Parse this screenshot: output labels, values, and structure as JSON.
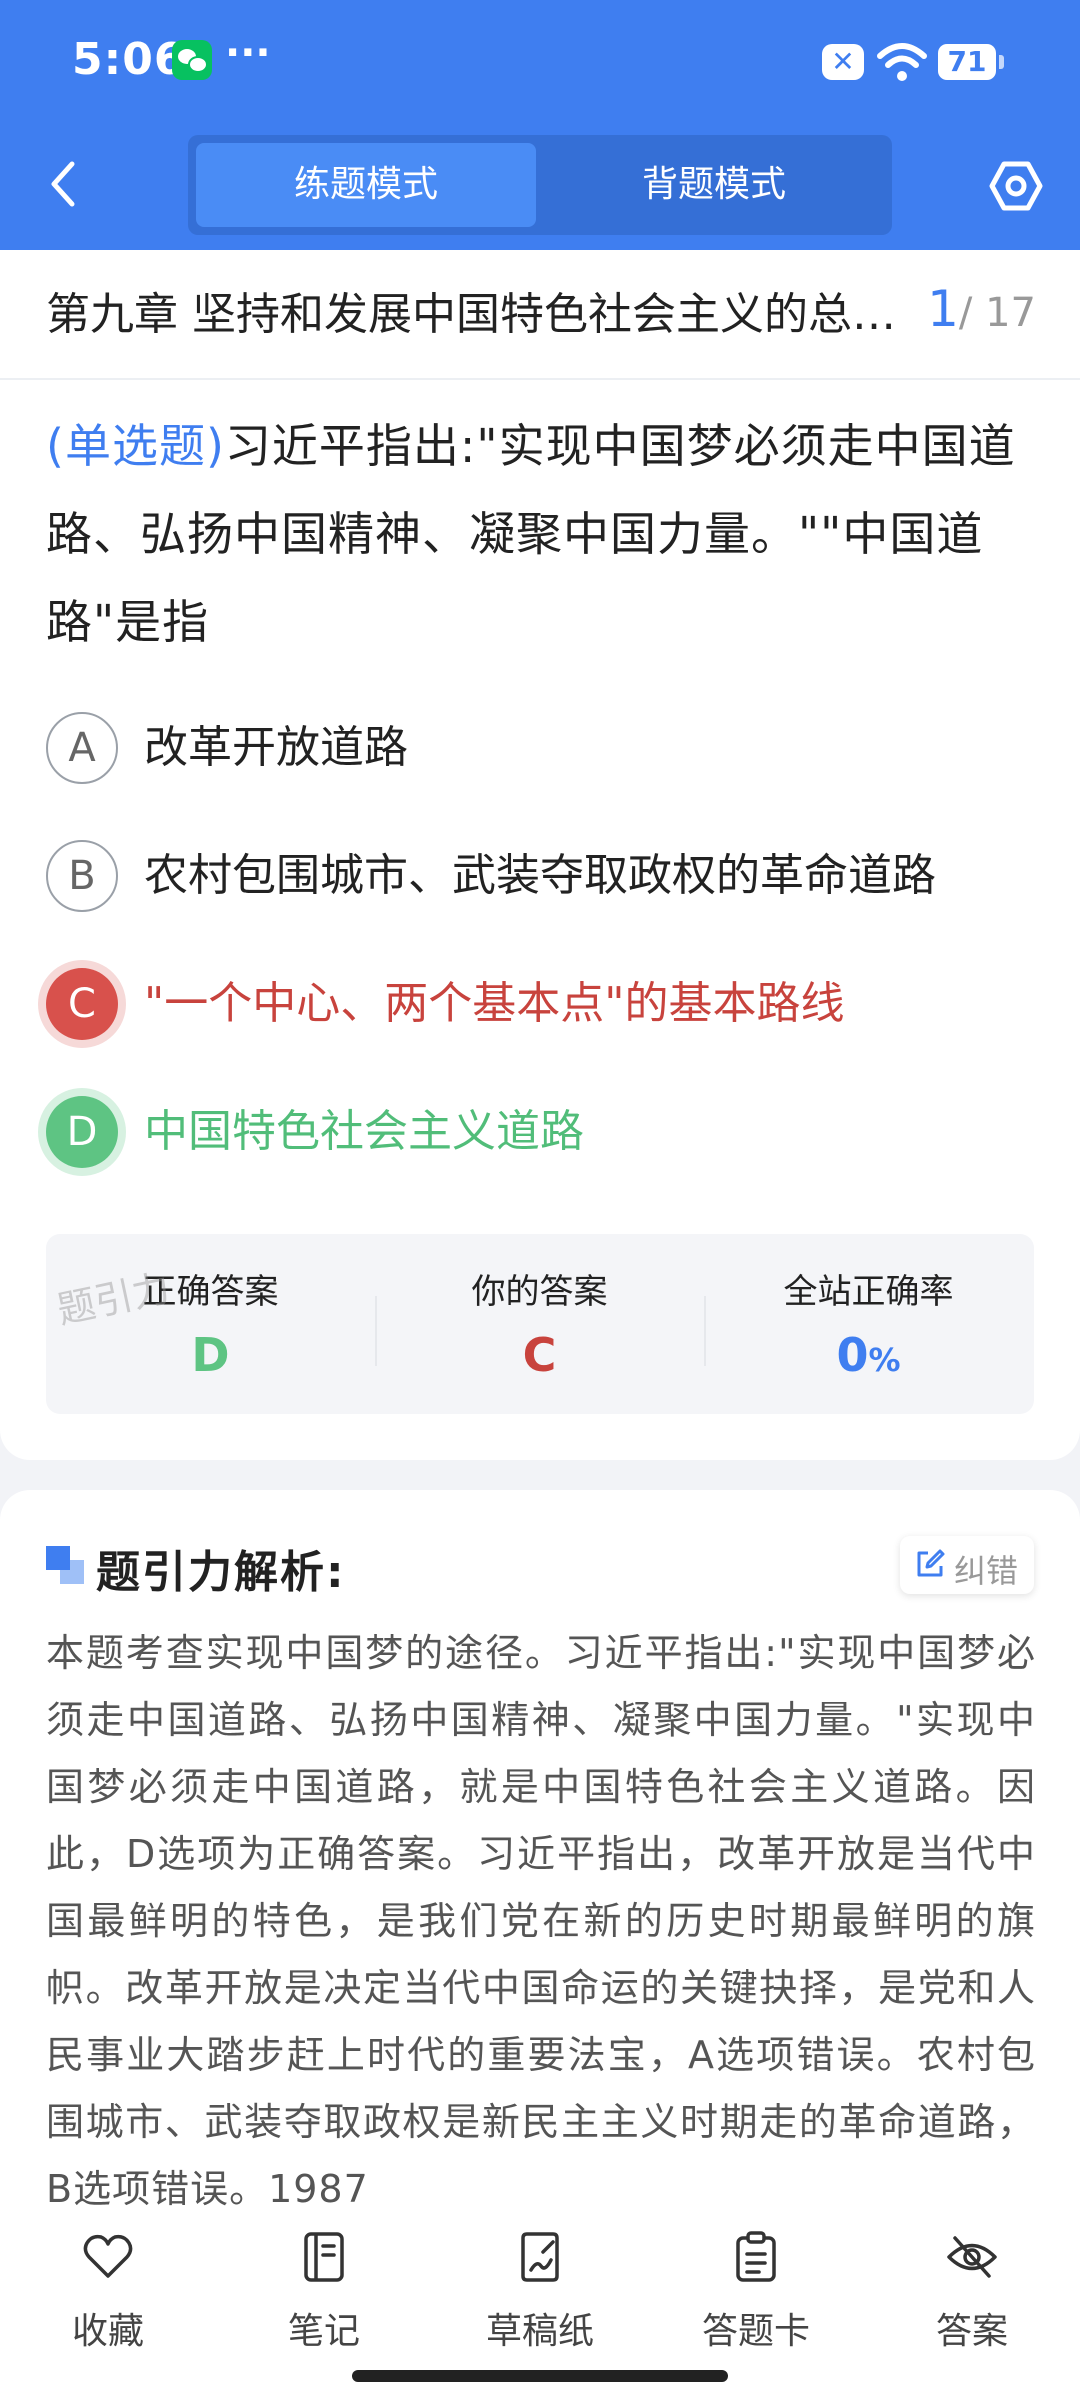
{
  "status_bar": {
    "time": "5:06",
    "dots": "···",
    "battery": "71"
  },
  "header": {
    "modes": [
      "练题模式",
      "背题模式"
    ],
    "active_mode": 0
  },
  "chapter": {
    "title": "第九章 坚持和发展中国特色社会主义的总任务",
    "current": "1",
    "total": "/ 17"
  },
  "question": {
    "type": "(单选题)",
    "stem": "习近平指出:\"实现中国梦必须走中国道路、弘扬中国精神、凝聚中国力量。\"\"中国道路\"是指",
    "options": [
      {
        "letter": "A",
        "text": "改革开放道路",
        "state": "normal"
      },
      {
        "letter": "B",
        "text": "农村包围城市、武装夺取政权的革命道路",
        "state": "normal"
      },
      {
        "letter": "C",
        "text": "\"一个中心、两个基本点\"的基本路线",
        "state": "wrong"
      },
      {
        "letter": "D",
        "text": "中国特色社会主义道路",
        "state": "right"
      }
    ]
  },
  "result": {
    "correct_label": "正确答案",
    "correct_value": "D",
    "yours_label": "你的答案",
    "yours_value": "C",
    "rate_label": "全站正确率",
    "rate_value": "0",
    "rate_unit": "%",
    "watermark": "题引力",
    "colors": {
      "correct": "#5ec483",
      "wrong": "#c8433d",
      "rate": "#3f7ef0"
    }
  },
  "analysis": {
    "title": "题引力解析:",
    "fix_label": "纠错",
    "body": "本题考查实现中国梦的途径。习近平指出:\"实现中国梦必须走中国道路、弘扬中国精神、凝聚中国力量。\"实现中国梦必须走中国道路，就是中国特色社会主义道路。因此，D选项为正确答案。习近平指出，改革开放是当代中国最鲜明的特色，是我们党在新的历史时期最鲜明的旗帜。改革开放是决定当代中国命运的关键抉择，是党和人民事业大踏步赶上时代的重要法宝，A选项错误。农村包围城市、武装夺取政权是新民主主义时期走的革命道路，B选项错误。1987"
  },
  "nav": [
    {
      "label": "收藏",
      "icon": "heart-icon"
    },
    {
      "label": "笔记",
      "icon": "notebook-icon"
    },
    {
      "label": "草稿纸",
      "icon": "draft-icon"
    },
    {
      "label": "答题卡",
      "icon": "answer-card-icon"
    },
    {
      "label": "答案",
      "icon": "eye-off-icon"
    }
  ],
  "theme": {
    "primary": "#3f7ef0"
  }
}
